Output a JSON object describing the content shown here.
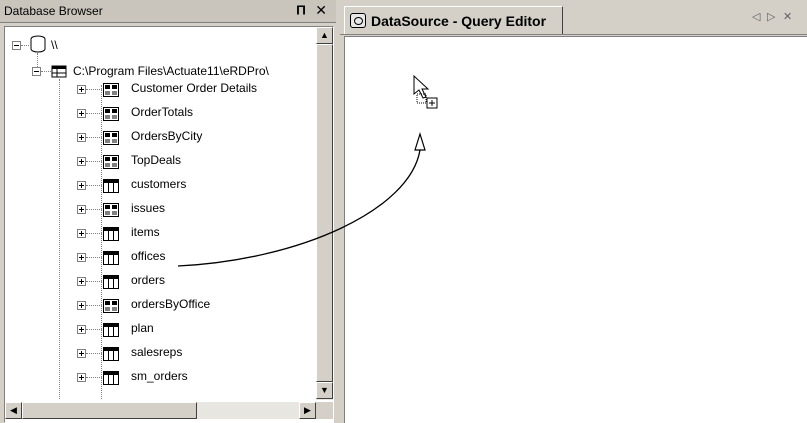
{
  "left_panel": {
    "title": "Database Browser",
    "pin_icon": "pin-icon",
    "close_icon": "close-icon",
    "root_label": "\\\\",
    "connection_label": "C:\\Program Files\\Actuate11\\eRDPro\\",
    "items": [
      {
        "label": "Customer Order Details",
        "icon": "query-icon",
        "selected": false
      },
      {
        "label": "OrderTotals",
        "icon": "query-icon",
        "selected": false
      },
      {
        "label": "OrdersByCity",
        "icon": "query-icon",
        "selected": false
      },
      {
        "label": "TopDeals",
        "icon": "query-icon",
        "selected": false
      },
      {
        "label": "customers",
        "icon": "table-icon",
        "selected": false
      },
      {
        "label": "issues",
        "icon": "query-icon",
        "selected": false
      },
      {
        "label": "items",
        "icon": "table-icon",
        "selected": false
      },
      {
        "label": "offices",
        "icon": "table-icon",
        "selected": true
      },
      {
        "label": "orders",
        "icon": "table-icon",
        "selected": false
      },
      {
        "label": "ordersByOffice",
        "icon": "query-icon",
        "selected": false
      },
      {
        "label": "plan",
        "icon": "table-icon",
        "selected": false
      },
      {
        "label": "salesreps",
        "icon": "table-icon",
        "selected": false
      },
      {
        "label": "sm_orders",
        "icon": "table-icon",
        "selected": false
      }
    ]
  },
  "right_panel": {
    "tab_title": "DataSource - Query Editor",
    "tab_icon": "datasource-icon",
    "nav_prev": "◁",
    "nav_next": "▷",
    "nav_close": "✕"
  },
  "scrollbar": {
    "up": "▲",
    "down": "▼",
    "left": "◀",
    "right": "▶"
  },
  "colors": {
    "selection": "#808080",
    "chrome": "#d4d0c8"
  }
}
